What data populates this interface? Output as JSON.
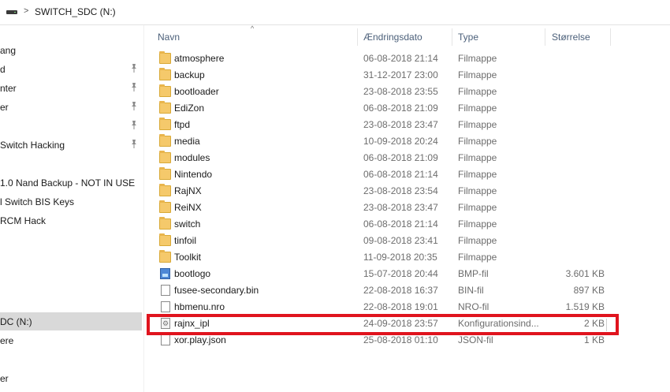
{
  "address": {
    "path": "SWITCH_SDC (N:)"
  },
  "nav": {
    "items": [
      {
        "label": "ang",
        "pinned": false
      },
      {
        "label": "d",
        "pinned": true
      },
      {
        "label": "nter",
        "pinned": true
      },
      {
        "label": "er",
        "pinned": true
      },
      {
        "label": "",
        "pinned": true
      },
      {
        "label": " Switch Hacking",
        "pinned": true
      },
      {
        "label": "",
        "pinned": false
      },
      {
        "label": "1.0 Nand Backup - NOT IN USE",
        "pinned": false
      },
      {
        "label": "l Switch BIS Keys",
        "pinned": false
      },
      {
        "label": "RCM Hack",
        "pinned": false
      },
      {
        "label": "",
        "pinned": false
      },
      {
        "label": "",
        "pinned": false
      },
      {
        "label": "DC (N:)",
        "pinned": false,
        "selected": true
      },
      {
        "label": "ere",
        "pinned": false
      },
      {
        "label": "",
        "pinned": false
      },
      {
        "label": "er",
        "pinned": false
      }
    ]
  },
  "columns": {
    "name": "Navn",
    "date": "Ændringsdato",
    "type": "Type",
    "size": "Størrelse"
  },
  "files": [
    {
      "name": "atmosphere",
      "date": "06-08-2018 21:14",
      "type": "Filmappe",
      "size": "",
      "icon": "folder-icon"
    },
    {
      "name": "backup",
      "date": "31-12-2017 23:00",
      "type": "Filmappe",
      "size": "",
      "icon": "folder-icon"
    },
    {
      "name": "bootloader",
      "date": "23-08-2018 23:55",
      "type": "Filmappe",
      "size": "",
      "icon": "folder-icon"
    },
    {
      "name": "EdiZon",
      "date": "06-08-2018 21:09",
      "type": "Filmappe",
      "size": "",
      "icon": "folder-icon"
    },
    {
      "name": "ftpd",
      "date": "23-08-2018 23:47",
      "type": "Filmappe",
      "size": "",
      "icon": "folder-icon"
    },
    {
      "name": "media",
      "date": "10-09-2018 20:24",
      "type": "Filmappe",
      "size": "",
      "icon": "folder-icon"
    },
    {
      "name": "modules",
      "date": "06-08-2018 21:09",
      "type": "Filmappe",
      "size": "",
      "icon": "folder-icon"
    },
    {
      "name": "Nintendo",
      "date": "06-08-2018 21:14",
      "type": "Filmappe",
      "size": "",
      "icon": "folder-icon"
    },
    {
      "name": "RajNX",
      "date": "23-08-2018 23:54",
      "type": "Filmappe",
      "size": "",
      "icon": "folder-icon"
    },
    {
      "name": "ReiNX",
      "date": "23-08-2018 23:47",
      "type": "Filmappe",
      "size": "",
      "icon": "folder-icon"
    },
    {
      "name": "switch",
      "date": "06-08-2018 21:14",
      "type": "Filmappe",
      "size": "",
      "icon": "folder-icon"
    },
    {
      "name": "tinfoil",
      "date": "09-08-2018 23:41",
      "type": "Filmappe",
      "size": "",
      "icon": "folder-icon"
    },
    {
      "name": "Toolkit",
      "date": "11-09-2018 20:35",
      "type": "Filmappe",
      "size": "",
      "icon": "folder-icon"
    },
    {
      "name": "bootlogo",
      "date": "15-07-2018 20:44",
      "type": "BMP-fil",
      "size": "3.601 KB",
      "icon": "bmp-file-icon"
    },
    {
      "name": "fusee-secondary.bin",
      "date": "22-08-2018 16:37",
      "type": "BIN-fil",
      "size": "897 KB",
      "icon": "file-icon"
    },
    {
      "name": "hbmenu.nro",
      "date": "22-08-2018 19:01",
      "type": "NRO-fil",
      "size": "1.519 KB",
      "icon": "file-icon"
    },
    {
      "name": "rajnx_ipl",
      "date": "24-09-2018 23:57",
      "type": "Konfigurationsind...",
      "size": "2 KB",
      "icon": "config-file-icon",
      "highlighted": true
    },
    {
      "name": "xor.play.json",
      "date": "25-08-2018 01:10",
      "type": "JSON-fil",
      "size": "1 KB",
      "icon": "file-icon"
    }
  ],
  "colors": {
    "highlight": "#e0141e",
    "selected_nav": "#d9d9d9",
    "header_text": "#4c607a"
  }
}
